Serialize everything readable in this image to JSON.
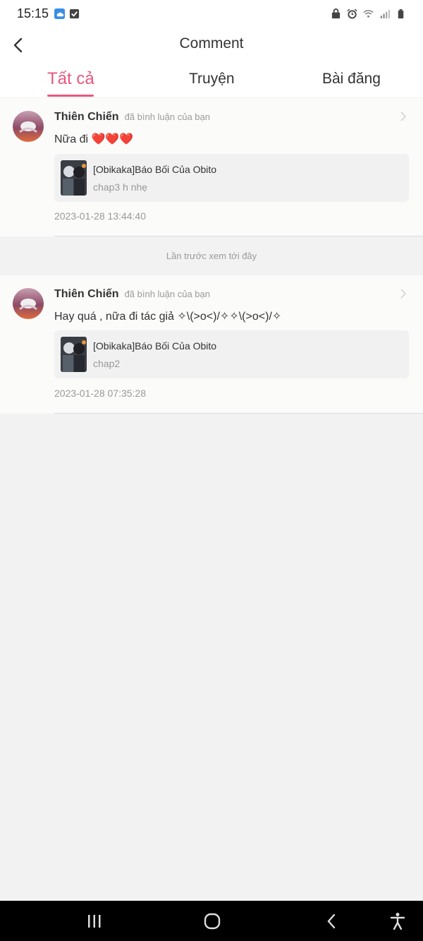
{
  "status_bar": {
    "time": "15:15",
    "left_icons": [
      "cloud-app-icon",
      "checkbox-icon"
    ],
    "right_icons": [
      "photo-lock-icon",
      "alarm-icon",
      "wifi-icon",
      "signal-icon",
      "battery-icon"
    ]
  },
  "header": {
    "back_icon": "chevron-left-icon",
    "title": "Comment"
  },
  "tabs": [
    {
      "label": "Tất cả",
      "active": true
    },
    {
      "label": "Truyện",
      "active": false
    },
    {
      "label": "Bài đăng",
      "active": false
    }
  ],
  "comments": [
    {
      "username": "Thiên Chiến",
      "action": "đã bình luận của bạn",
      "text": "Nữa đi ❤️❤️❤️",
      "story_title": "[Obikaka]Báo Bối Của Obito",
      "story_chapter": "chap3 h nhẹ",
      "timestamp": "2023-01-28 13:44:40"
    },
    {
      "username": "Thiên Chiến",
      "action": "đã bình luận của bạn",
      "text": "Hay quá , nữa đi tác giả ✧\\(>o<)/✧✧\\(>o<)/✧",
      "story_title": "[Obikaka]Báo Bối Của Obito",
      "story_chapter": "chap2",
      "timestamp": "2023-01-28 07:35:28"
    }
  ],
  "last_seen_text": "Lần trước xem tới đây",
  "colors": {
    "accent": "#e8577a",
    "page_bg": "#f2f2f2",
    "card_bg": "#fbfbfa"
  },
  "nav_bar": {
    "buttons": [
      "recent-apps-icon",
      "home-icon",
      "back-icon",
      "accessibility-icon"
    ]
  }
}
